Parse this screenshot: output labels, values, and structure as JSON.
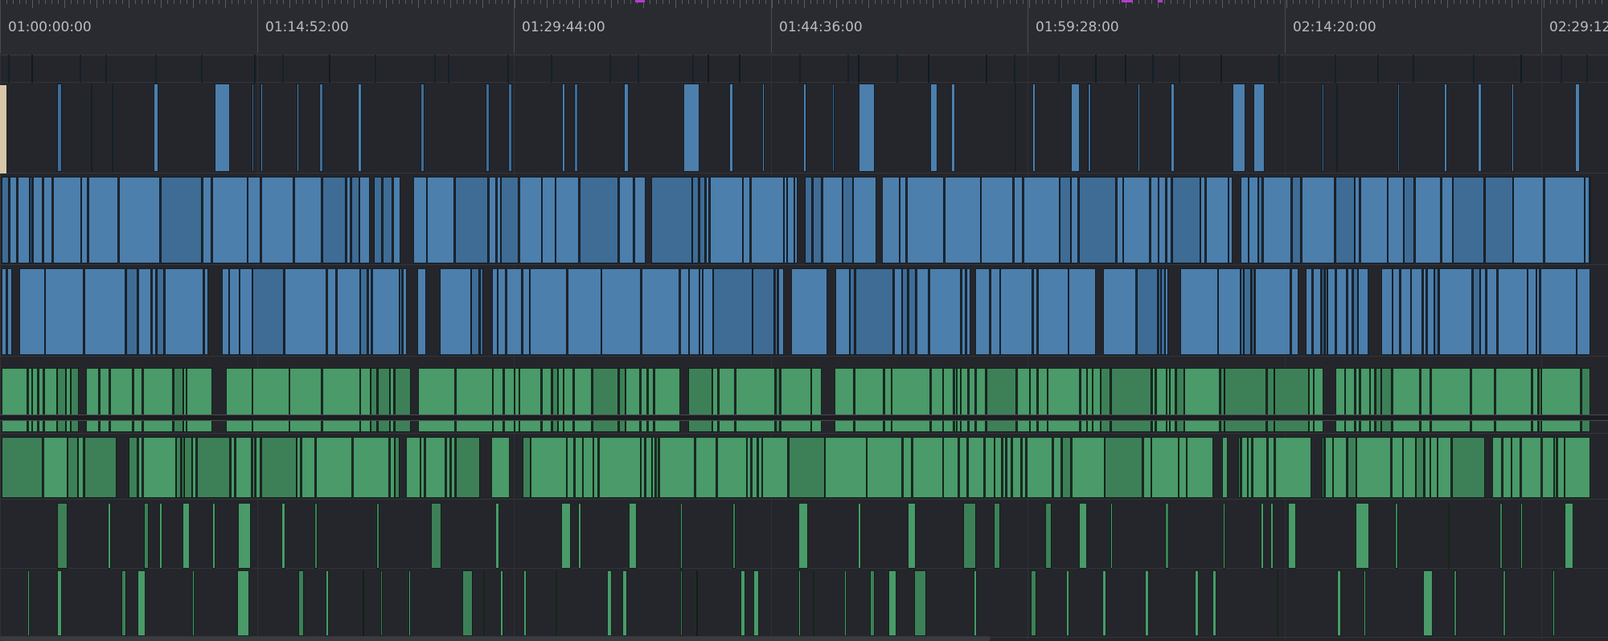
{
  "ruler": {
    "timecodes": [
      "01:00:00:00",
      "01:14:52:00",
      "01:29:44:00",
      "01:44:36:00",
      "01:59:28:00",
      "02:14:20:00",
      "02:29:12:"
    ]
  },
  "colors": {
    "background": "#25262b",
    "video_clip": "#4d7fac",
    "audio_clip": "#4a9a6a",
    "marker": "#b040c8",
    "playhead_clip": "#d8c7a8"
  },
  "tracks": [
    {
      "kind": "video",
      "name": ""
    },
    {
      "kind": "video",
      "name": ""
    },
    {
      "kind": "video",
      "name": ""
    },
    {
      "kind": "video",
      "name": ""
    },
    {
      "kind": "audio",
      "name": ""
    },
    {
      "kind": "audio",
      "name": ""
    },
    {
      "kind": "audio",
      "name": ""
    },
    {
      "kind": "audio",
      "name": ""
    }
  ]
}
